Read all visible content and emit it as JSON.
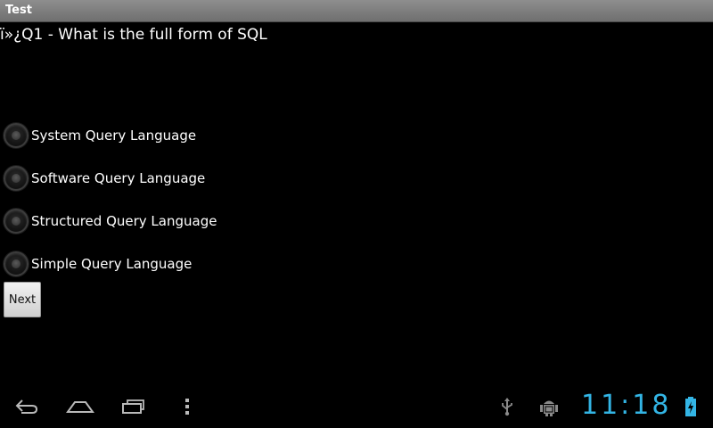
{
  "app": {
    "title": "Test"
  },
  "quiz": {
    "question": "ï»¿Q1 - What is the full form of SQL",
    "options": [
      {
        "label": "System Query Language"
      },
      {
        "label": "Software Query Language"
      },
      {
        "label": "Structured Query Language"
      },
      {
        "label": "Simple Query Language"
      }
    ],
    "next_label": "Next"
  },
  "statusbar": {
    "time": "11:18",
    "icons": [
      "usb-icon",
      "android-debug-icon",
      "battery-icon"
    ]
  },
  "navigation": {
    "icons": [
      "back-icon",
      "home-icon",
      "recent-apps-icon",
      "menu-icon"
    ]
  },
  "colors": {
    "clock": "#33b5e5",
    "background": "#000000",
    "titlebar": "#7a7a7a"
  }
}
